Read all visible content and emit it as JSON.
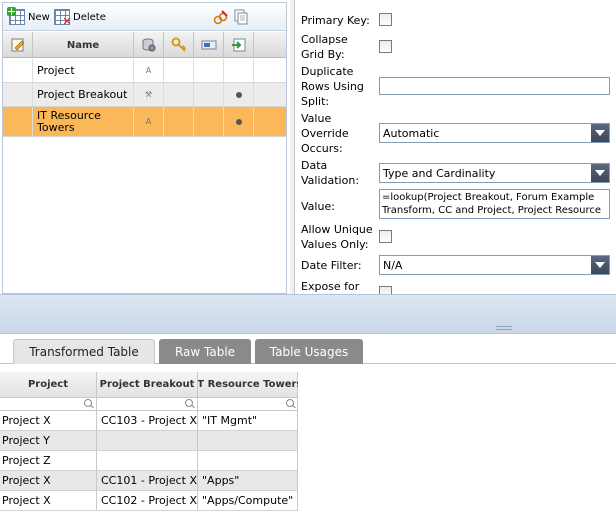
{
  "toolbar": {
    "new_label": "New",
    "delete_label": "Delete"
  },
  "column_grid": {
    "header": {
      "name_label": "Name"
    },
    "rows": [
      {
        "name": "Project",
        "type_glyph": "A",
        "has_dot": false
      },
      {
        "name": "Project Breakout",
        "type_glyph": "⚒",
        "has_dot": true
      },
      {
        "name": "IT Resource Towers",
        "type_glyph": "A",
        "has_dot": true
      }
    ],
    "selected_index": 2
  },
  "properties": {
    "primary_key": {
      "label": "Primary Key:",
      "checked": false
    },
    "collapse_grid_by": {
      "label": "Collapse Grid By:",
      "checked": false
    },
    "duplicate_rows": {
      "label": "Duplicate Rows Using Split:",
      "value": ""
    },
    "value_override": {
      "label": "Value Override Occurs:",
      "value": "Automatic"
    },
    "data_validation": {
      "label": "Data Validation:",
      "value": "Type and Cardinality"
    },
    "value": {
      "label": "Value:",
      "value": "=lookup(Project Breakout, Forum Example Transform, CC and Project, Project Resource"
    },
    "allow_unique": {
      "label": "Allow Unique Values Only:",
      "checked": false
    },
    "date_filter": {
      "label": "Date Filter:",
      "value": "N/A"
    },
    "expose_for": {
      "label": "Expose for",
      "checked": false
    }
  },
  "tabs": [
    {
      "label": "Transformed Table",
      "active": true
    },
    {
      "label": "Raw Table",
      "active": false
    },
    {
      "label": "Table Usages",
      "active": false
    }
  ],
  "data_grid": {
    "columns": [
      "Project",
      "Project Breakout",
      "IT Resource Towers"
    ],
    "rows": [
      [
        "Project X",
        "CC103 - Project X",
        "\"IT Mgmt\""
      ],
      [
        "Project Y",
        "",
        ""
      ],
      [
        "Project Z",
        "",
        ""
      ],
      [
        "Project X",
        "CC101 - Project X",
        "\"Apps\""
      ],
      [
        "Project X",
        "CC102 - Project X",
        "\"Apps/Compute\""
      ]
    ]
  },
  "colors": {
    "selected_row": "#fbb859",
    "tab_inactive": "#8a8a8a",
    "splitter": "#c9d7e8"
  }
}
